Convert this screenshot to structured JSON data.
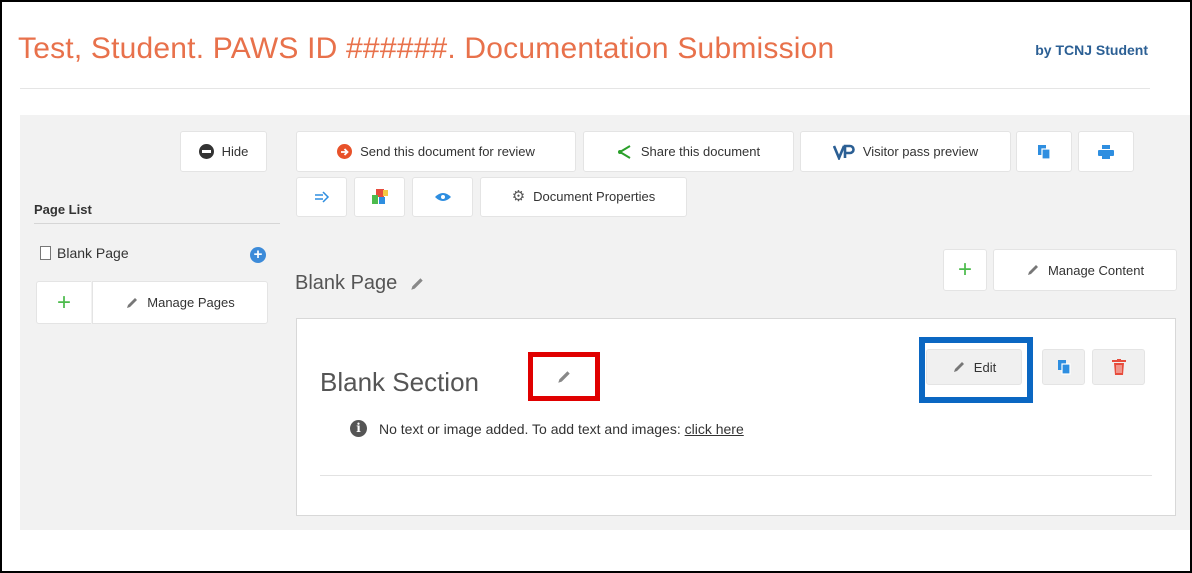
{
  "header": {
    "title": "Test, Student. PAWS ID ######. Documentation Submission",
    "author": "by TCNJ Student"
  },
  "toolbar": {
    "hide_label": "Hide",
    "send_label": "Send this document for review",
    "share_label": "Share this document",
    "visitor_label": "Visitor pass preview",
    "doc_props_label": "Document Properties"
  },
  "sidebar": {
    "page_list_label": "Page List",
    "pages": [
      {
        "label": "Blank Page"
      }
    ],
    "manage_pages_label": "Manage Pages"
  },
  "main": {
    "page_title": "Blank Page",
    "manage_content_label": "Manage Content",
    "section": {
      "title": "Blank Section",
      "edit_label": "Edit",
      "info_text": "No text or image added. To add text and images:",
      "info_link": "click here"
    }
  },
  "colors": {
    "title_orange": "#e8714b",
    "highlight_red": "#e00000",
    "highlight_blue": "#0b67c2",
    "add_green": "#4cbb4c",
    "delete_red": "#e74c3c",
    "action_blue": "#2e8ee0"
  },
  "icons": [
    "minus-circle-icon",
    "arrow-right-circle-icon",
    "share-icon",
    "vp-logo-icon",
    "copy-icon",
    "print-icon",
    "export-icon",
    "color-blocks-icon",
    "eye-icon",
    "gear-icon",
    "file-icon",
    "plus-circle-icon",
    "plus-icon",
    "pencil-icon",
    "info-icon",
    "trash-icon"
  ]
}
